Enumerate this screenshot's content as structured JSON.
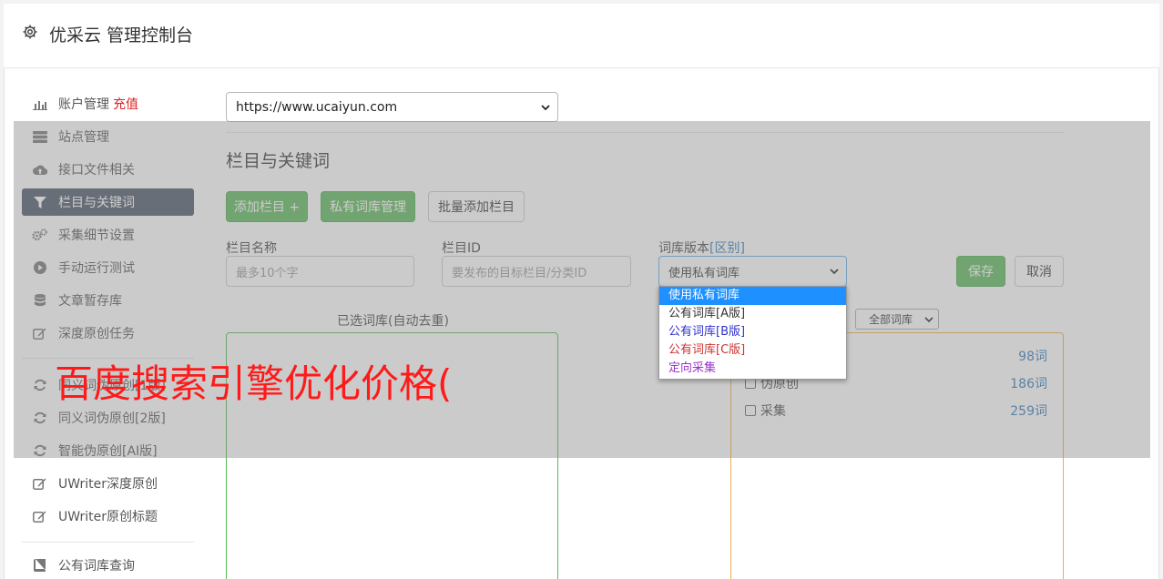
{
  "header": {
    "title": "优采云 管理控制台",
    "icon": "gear-icon"
  },
  "sidebar": {
    "items": [
      {
        "label": "账户管理",
        "badge": "充值",
        "icon": "bar-chart-icon"
      },
      {
        "label": "站点管理",
        "icon": "server-icon"
      },
      {
        "label": "接口文件相关",
        "icon": "cloud-upload-icon"
      },
      {
        "label": "栏目与关键词",
        "icon": "filter-icon",
        "active": true
      },
      {
        "label": "采集细节设置",
        "icon": "gears-icon"
      },
      {
        "label": "手动运行测试",
        "icon": "play-circle-icon"
      },
      {
        "label": "文章暂存库",
        "icon": "database-icon"
      },
      {
        "label": "深度原创任务",
        "icon": "edit-icon"
      },
      {
        "label": "同义词伪原创[1版]",
        "icon": "refresh-icon"
      },
      {
        "label": "同义词伪原创[2版]",
        "icon": "refresh-icon"
      },
      {
        "label": "智能伪原创[AI版]",
        "icon": "refresh-icon"
      },
      {
        "label": "UWriter深度原创",
        "icon": "edit-icon"
      },
      {
        "label": "UWriter原创标题",
        "icon": "edit-icon"
      },
      {
        "label": "公有词库查询",
        "icon": "book-icon"
      }
    ]
  },
  "site_select": {
    "value": "https://www.ucaiyun.com"
  },
  "section": {
    "title": "栏目与关键词"
  },
  "buttons": {
    "add_column": "添加栏目 +",
    "private_lib": "私有词库管理",
    "batch_add": "批量添加栏目",
    "save": "保存",
    "cancel": "取消"
  },
  "form": {
    "column_name_label": "栏目名称",
    "column_name_placeholder": "最多10个字",
    "column_id_label": "栏目ID",
    "column_id_placeholder": "要发布的目标栏目/分类ID",
    "lib_version_label": "词库版本",
    "lib_version_link": "[区别]",
    "lib_version_value": "使用私有词库",
    "lib_version_options": [
      {
        "label": "使用私有词库",
        "color": "#ffffff"
      },
      {
        "label": "公有词库[A版]",
        "color": "#333333"
      },
      {
        "label": "公有词库[B版]",
        "color": "#3333cc"
      },
      {
        "label": "公有词库[C版]",
        "color": "#cc3333"
      },
      {
        "label": "定向采集",
        "color": "#9933cc"
      }
    ]
  },
  "selected_lib": {
    "title": "已选词库(自动去重)"
  },
  "library": {
    "filter_value": "全部词库",
    "rows": [
      {
        "label": "",
        "count": "98词"
      },
      {
        "label": "伪原创",
        "count": "186词"
      },
      {
        "label": "采集",
        "count": "259词"
      }
    ]
  },
  "overlay": {
    "text": "百度搜索引擎优化价格("
  },
  "colors": {
    "green": "#5cb85c",
    "orange": "#f0ad4e",
    "active_nav": "#4c5666",
    "link": "#337ab7",
    "recharge": "#e02020"
  }
}
